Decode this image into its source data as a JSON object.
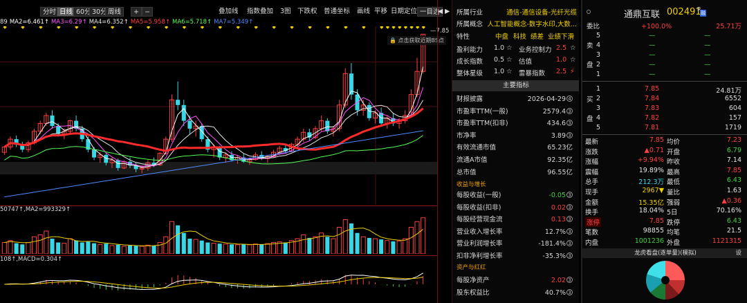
{
  "toolbar": {
    "buttons": [
      "分时",
      "日线",
      "60分",
      "30分",
      "周线"
    ],
    "active": 1,
    "plus": "+",
    "minus": "−",
    "dropdowns": [
      "叠加线",
      "指数叠加",
      "3图",
      "下跌权",
      "普通坐标"
    ],
    "items": [
      "画线",
      "平移",
      "日期定位"
    ],
    "selector": "一目选",
    "nav_prev": "◀",
    "nav_next": "▶"
  },
  "ma_legend": [
    {
      "text": "89",
      "color": "#e6e6e6"
    },
    {
      "text": "MA2=6.461",
      "color": "#ffffff"
    },
    {
      "text": "MA3=6.29",
      "color": "#ff55ff"
    },
    {
      "text": "MA4=6.352",
      "color": "#e6e6e6"
    },
    {
      "text": "MA5=5.958",
      "color": "#ff4040"
    },
    {
      "text": "MA6=5.718",
      "color": "#55ff55"
    },
    {
      "text": "MA7=5.349",
      "color": "#4c8cff"
    }
  ],
  "price_label": "7.85",
  "hint": "点击获取近期BS点",
  "vol_legend": "50747↑,MA2=993329↑",
  "macd_legend": "108↑,MACD=0.304↑",
  "candles": [
    [
      5.6,
      5.72,
      5.55,
      5.7
    ],
    [
      5.7,
      5.9,
      5.65,
      5.85
    ],
    [
      5.85,
      5.92,
      5.7,
      5.75
    ],
    [
      5.75,
      5.8,
      5.6,
      5.65
    ],
    [
      5.65,
      5.82,
      5.6,
      5.78
    ],
    [
      5.78,
      6.05,
      5.75,
      6.0
    ],
    [
      6.0,
      6.2,
      5.95,
      6.15
    ],
    [
      6.15,
      6.35,
      6.1,
      6.3
    ],
    [
      6.3,
      6.4,
      6.05,
      6.1
    ],
    [
      6.1,
      6.15,
      5.9,
      5.95
    ],
    [
      5.95,
      6.05,
      5.85,
      6.0
    ],
    [
      6.0,
      6.22,
      5.95,
      6.2
    ],
    [
      6.2,
      6.3,
      6.0,
      6.05
    ],
    [
      6.05,
      6.1,
      5.8,
      5.85
    ],
    [
      5.85,
      5.9,
      5.6,
      5.65
    ],
    [
      5.65,
      5.7,
      5.45,
      5.5
    ],
    [
      5.5,
      5.6,
      5.4,
      5.55
    ],
    [
      5.55,
      5.58,
      5.35,
      5.4
    ],
    [
      5.4,
      5.5,
      5.3,
      5.45
    ],
    [
      5.45,
      5.48,
      5.25,
      5.3
    ],
    [
      5.3,
      5.45,
      5.28,
      5.42
    ],
    [
      5.42,
      5.5,
      5.3,
      5.35
    ],
    [
      5.35,
      5.4,
      5.22,
      5.28
    ],
    [
      5.28,
      5.35,
      5.2,
      5.3
    ],
    [
      5.3,
      5.45,
      5.25,
      5.4
    ],
    [
      5.4,
      5.5,
      5.32,
      5.36
    ],
    [
      5.36,
      5.6,
      5.34,
      5.58
    ],
    [
      5.58,
      5.9,
      5.55,
      5.85
    ],
    [
      5.85,
      6.7,
      5.8,
      6.6
    ],
    [
      6.6,
      6.95,
      6.4,
      6.5
    ],
    [
      6.5,
      6.6,
      6.1,
      6.2
    ],
    [
      6.2,
      6.3,
      5.95,
      6.05
    ],
    [
      6.05,
      6.2,
      5.9,
      6.1
    ],
    [
      6.1,
      6.15,
      5.8,
      5.85
    ],
    [
      5.85,
      5.9,
      5.6,
      5.65
    ],
    [
      5.65,
      5.75,
      5.5,
      5.7
    ],
    [
      5.7,
      5.72,
      5.45,
      5.5
    ],
    [
      5.5,
      5.6,
      5.4,
      5.55
    ],
    [
      5.55,
      5.62,
      5.42,
      5.45
    ],
    [
      5.45,
      5.55,
      5.38,
      5.5
    ],
    [
      5.5,
      5.58,
      5.4,
      5.42
    ],
    [
      5.42,
      5.5,
      5.36,
      5.46
    ],
    [
      5.46,
      5.6,
      5.44,
      5.55
    ],
    [
      5.55,
      5.62,
      5.45,
      5.48
    ],
    [
      5.48,
      5.55,
      5.4,
      5.52
    ],
    [
      5.52,
      5.65,
      5.5,
      5.6
    ],
    [
      5.6,
      5.72,
      5.55,
      5.68
    ],
    [
      5.68,
      5.75,
      5.58,
      5.62
    ],
    [
      5.62,
      5.78,
      5.6,
      5.75
    ],
    [
      5.75,
      5.9,
      5.7,
      5.85
    ],
    [
      5.85,
      6.05,
      5.8,
      5.98
    ],
    [
      5.98,
      6.05,
      5.82,
      5.88
    ],
    [
      5.88,
      6.1,
      5.85,
      6.05
    ],
    [
      6.05,
      6.3,
      6.0,
      6.2
    ],
    [
      6.2,
      6.25,
      5.95,
      6.0
    ],
    [
      6.0,
      6.1,
      5.9,
      6.05
    ],
    [
      6.05,
      6.6,
      6.0,
      6.5
    ],
    [
      6.5,
      7.2,
      6.45,
      7.1
    ],
    [
      7.1,
      7.3,
      6.6,
      6.7
    ],
    [
      6.7,
      6.8,
      6.3,
      6.4
    ],
    [
      6.4,
      6.6,
      6.3,
      6.5
    ],
    [
      6.5,
      6.55,
      6.2,
      6.25
    ],
    [
      6.25,
      6.4,
      6.15,
      6.35
    ],
    [
      6.35,
      6.45,
      6.1,
      6.15
    ],
    [
      6.15,
      6.3,
      6.05,
      6.25
    ],
    [
      6.25,
      6.35,
      6.1,
      6.15
    ],
    [
      6.15,
      6.25,
      6.05,
      6.2
    ],
    [
      6.2,
      6.4,
      6.15,
      6.3
    ],
    [
      6.3,
      6.8,
      6.28,
      6.7
    ],
    [
      6.7,
      7.4,
      6.65,
      7.14
    ],
    [
      7.14,
      7.85,
      7.1,
      7.85
    ]
  ],
  "volumes": [
    0.3,
    0.35,
    0.28,
    0.25,
    0.3,
    0.45,
    0.5,
    0.6,
    0.4,
    0.3,
    0.28,
    0.4,
    0.35,
    0.3,
    0.32,
    0.28,
    0.25,
    0.27,
    0.22,
    0.24,
    0.2,
    0.22,
    0.21,
    0.2,
    0.23,
    0.22,
    0.3,
    0.45,
    0.85,
    0.75,
    0.55,
    0.4,
    0.38,
    0.35,
    0.3,
    0.28,
    0.27,
    0.26,
    0.25,
    0.24,
    0.25,
    0.24,
    0.26,
    0.25,
    0.27,
    0.3,
    0.32,
    0.3,
    0.35,
    0.4,
    0.5,
    0.42,
    0.45,
    0.55,
    0.45,
    0.4,
    0.7,
    0.9,
    0.8,
    0.55,
    0.45,
    0.42,
    0.4,
    0.38,
    0.35,
    0.33,
    0.34,
    0.4,
    0.7,
    0.85,
    0.95
  ],
  "fin": {
    "industry_label": "所属行业",
    "industry": "通信-通信设备-光纤光缆",
    "concept_label": "所属概念",
    "concept": "人工智能概念-数字水印,大数...",
    "feature_label": "特性",
    "features": [
      "中盘",
      "科技",
      "绩差",
      "业绩下滑"
    ],
    "ratings": [
      {
        "label": "盈利能力",
        "v1": "1.0",
        "l2": "业务控制力",
        "v2": "2.5"
      },
      {
        "label": "成长指数",
        "v1": "0.5",
        "l2": "估值",
        "v2": "1.0"
      },
      {
        "label": "整体星级",
        "v1": "1.0",
        "l2": "雷暴指数",
        "v2": "2.5"
      }
    ],
    "star": "☆",
    "lightning": "⚡",
    "section_title": "主要指标",
    "rows": [
      {
        "label": "财报披露",
        "value": "2026-04-29",
        "mark": "④"
      },
      {
        "label": "市盈率TTM(一般)",
        "value": "2579.4",
        "mark": "③"
      },
      {
        "label": "市盈率TTM(扣非)",
        "value": "434.6",
        "mark": "③"
      },
      {
        "label": "市净率",
        "value": "3.89",
        "mark": "③"
      },
      {
        "label": "有效流通市值",
        "value": "65.23亿",
        "mark": ""
      },
      {
        "label": "流通A市值",
        "value": "92.35亿",
        "mark": ""
      },
      {
        "label": "总市值",
        "value": "96.55亿",
        "mark": ""
      }
    ],
    "growth_title": "收益与增长",
    "growth": [
      {
        "label": "每股收益(一般)",
        "value": "-0.05",
        "mark": "③",
        "color": "#3fd23f"
      },
      {
        "label": "每股收益(扣非)",
        "value": "0.02",
        "mark": "③",
        "color": "#ff4040"
      },
      {
        "label": "每股经营现金流",
        "value": "0.13",
        "mark": "③",
        "color": "#ff4040"
      },
      {
        "label": "营业收入增长率",
        "value": "12.7%",
        "mark": "③",
        "color": "#d8d8d8"
      },
      {
        "label": "营业利润增长率",
        "value": "-181.4%",
        "mark": "③",
        "color": "#d8d8d8"
      },
      {
        "label": "扣非净利增长率",
        "value": "-35.3%",
        "mark": "③",
        "color": "#d8d8d8"
      }
    ],
    "asset_title": "资产与红红",
    "assets": [
      {
        "label": "每股净资产",
        "value": "2.02",
        "mark": "③",
        "color": "#ff4040"
      },
      {
        "label": "股东权益比",
        "value": "40.7%",
        "mark": "③",
        "color": "#d8d8d8"
      }
    ]
  },
  "quote": {
    "name": "通鼎互联",
    "code": "002491",
    "badge": "R",
    "badge2": "融",
    "webi_label": "委比",
    "webi": "+100.0%",
    "webi_right": "25.71万",
    "sell_label": [
      "卖",
      "盘"
    ],
    "sell": [
      {
        "lv": "5",
        "p": "—",
        "v": "—"
      },
      {
        "lv": "4",
        "p": "—",
        "v": "—"
      },
      {
        "lv": "3",
        "p": "—",
        "v": "—"
      },
      {
        "lv": "2",
        "p": "—",
        "v": "—"
      },
      {
        "lv": "1",
        "p": "—",
        "v": "—"
      }
    ],
    "buy_label": [
      "买",
      "盘"
    ],
    "buy": [
      {
        "lv": "1",
        "p": "7.85",
        "v": "24.81万"
      },
      {
        "lv": "2",
        "p": "7.84",
        "v": "6552"
      },
      {
        "lv": "3",
        "p": "7.83",
        "v": "604"
      },
      {
        "lv": "4",
        "p": "7.82",
        "v": "157"
      },
      {
        "lv": "5",
        "p": "7.81",
        "v": "1719"
      }
    ],
    "stats": [
      {
        "l1": "最新",
        "v1": "7.85",
        "c1": "red",
        "l2": "均价",
        "v2": "7.23",
        "c2": "red"
      },
      {
        "l1": "涨跌",
        "v1": "▲0.71",
        "c1": "red",
        "l2": "开盘",
        "v2": "6.79",
        "c2": "green"
      },
      {
        "l1": "涨幅",
        "v1": "+9.94%",
        "c1": "red",
        "l2": "昨收",
        "v2": "7.14",
        "c2": "white"
      },
      {
        "l1": "震幅",
        "v1": "19.89%",
        "c1": "white",
        "l2": "最高",
        "v2": "7.85",
        "c2": "red"
      },
      {
        "l1": "总手",
        "v1": "212.3万",
        "c1": "cyan",
        "l2": "最低",
        "v2": "6.43",
        "c2": "green"
      },
      {
        "l1": "现手",
        "v1": "2967▼",
        "c1": "yellow",
        "l2": "量比",
        "v2": "1.63",
        "c2": "white"
      },
      {
        "l1": "金额",
        "v1": "15.35亿",
        "c1": "yellow",
        "l2": "强弱",
        "v2": "▲0.36",
        "c2": "red"
      },
      {
        "l1": "换手",
        "v1": "18.04%",
        "c1": "white",
        "l2": "5日",
        "v2": "70.16%",
        "c2": "white"
      },
      {
        "l1": "涨停",
        "v1": "7.85",
        "c1": "red",
        "l2": "跌停",
        "v2": "6.43",
        "c2": "green"
      },
      {
        "l1": "笔数",
        "v1": "98855",
        "c1": "white",
        "l2": "均笔",
        "v2": "21.5",
        "c2": "white"
      },
      {
        "l1": "内盘",
        "v1": "1001236",
        "c1": "green",
        "l2": "外盘",
        "v2": "1121315",
        "c2": "red"
      }
    ],
    "lhb_title": "龙虎看盘(逐单量)(模拟)",
    "lhb_btn": "设",
    "pie": [
      {
        "name": "big-buy",
        "value": 0.25,
        "color": "#ff5a5a"
      },
      {
        "name": "mid-buy",
        "value": 0.13,
        "color": "#c03030"
      },
      {
        "name": "small-buy",
        "value": 0.12,
        "color": "#7a1a1a"
      },
      {
        "name": "small-sell",
        "value": 0.14,
        "color": "#1a7a35"
      },
      {
        "name": "mid-sell",
        "value": 0.16,
        "color": "#1a9fb0"
      },
      {
        "name": "big-sell",
        "value": 0.2,
        "color": "#40e0e8"
      }
    ]
  }
}
